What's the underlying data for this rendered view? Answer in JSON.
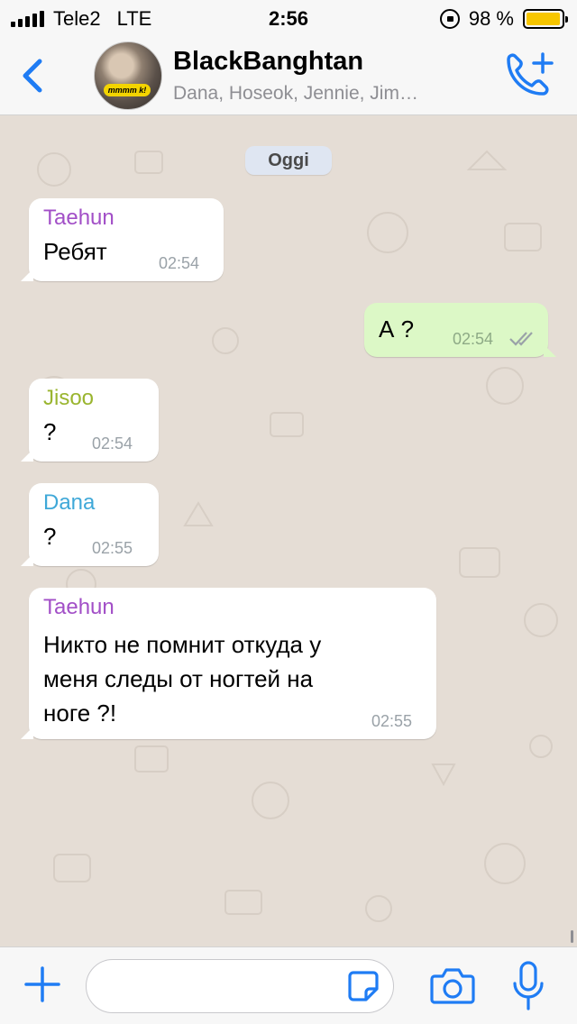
{
  "status_bar": {
    "carrier": "Tele2",
    "network": "LTE",
    "time": "2:56",
    "battery_percent": "98 %",
    "battery_level": 0.98,
    "battery_color": "#f7c600"
  },
  "header": {
    "back_icon": "chevron-left-icon",
    "title": "BlackBanghtan",
    "members": "Dana, Hoseok, Jennie, Jim…",
    "avatar_sticker_text": "mmmm k!",
    "call_icon": "add-phone-call-icon",
    "accent_color": "#1f7cf4"
  },
  "chat": {
    "date_label": "Oggi",
    "background_color": "#e5ddd5",
    "messages": [
      {
        "direction": "in",
        "sender": "Taehun",
        "sender_color": "#a24fc7",
        "text": "Ребят",
        "time": "02:54"
      },
      {
        "direction": "out",
        "text": "А ?",
        "time": "02:54",
        "status": "read-double-check"
      },
      {
        "direction": "in",
        "sender": "Jisoo",
        "sender_color": "#9ab52f",
        "text": "?",
        "time": "02:54"
      },
      {
        "direction": "in",
        "sender": "Dana",
        "sender_color": "#3fa8d8",
        "text": "?",
        "time": "02:55"
      },
      {
        "direction": "in",
        "sender": "Taehun",
        "sender_color": "#a24fc7",
        "text_lines": [
          "Никто не помнит откуда у",
          "меня следы от ногтей на",
          "ноге ?!"
        ],
        "time": "02:55"
      }
    ]
  },
  "input_bar": {
    "plus_icon": "plus-icon",
    "message_value": "",
    "sticker_icon": "sticker-icon",
    "camera_icon": "camera-icon",
    "mic_icon": "microphone-icon"
  }
}
